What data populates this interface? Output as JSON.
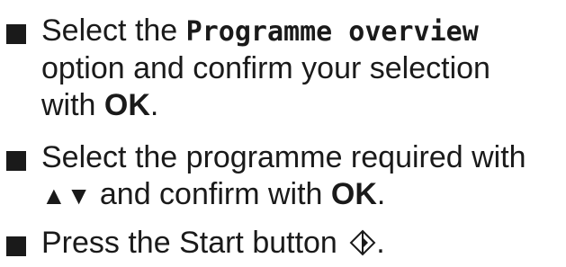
{
  "steps": [
    {
      "line1_pre": "Select the ",
      "display_term": "Programme overview",
      "line2": "option and confirm your selection",
      "line3_pre": "with ",
      "bold": "OK",
      "line3_post": "."
    },
    {
      "line1": "Select the programme required with",
      "arrows": "▲▼",
      "line2_mid": " and confirm with ",
      "bold": "OK",
      "line2_post": "."
    },
    {
      "line1_pre": "Press the Start button ",
      "icon": "start-button-icon",
      "line1_post": "."
    }
  ],
  "colors": {
    "text": "#1a1a1a",
    "background": "#ffffff"
  }
}
